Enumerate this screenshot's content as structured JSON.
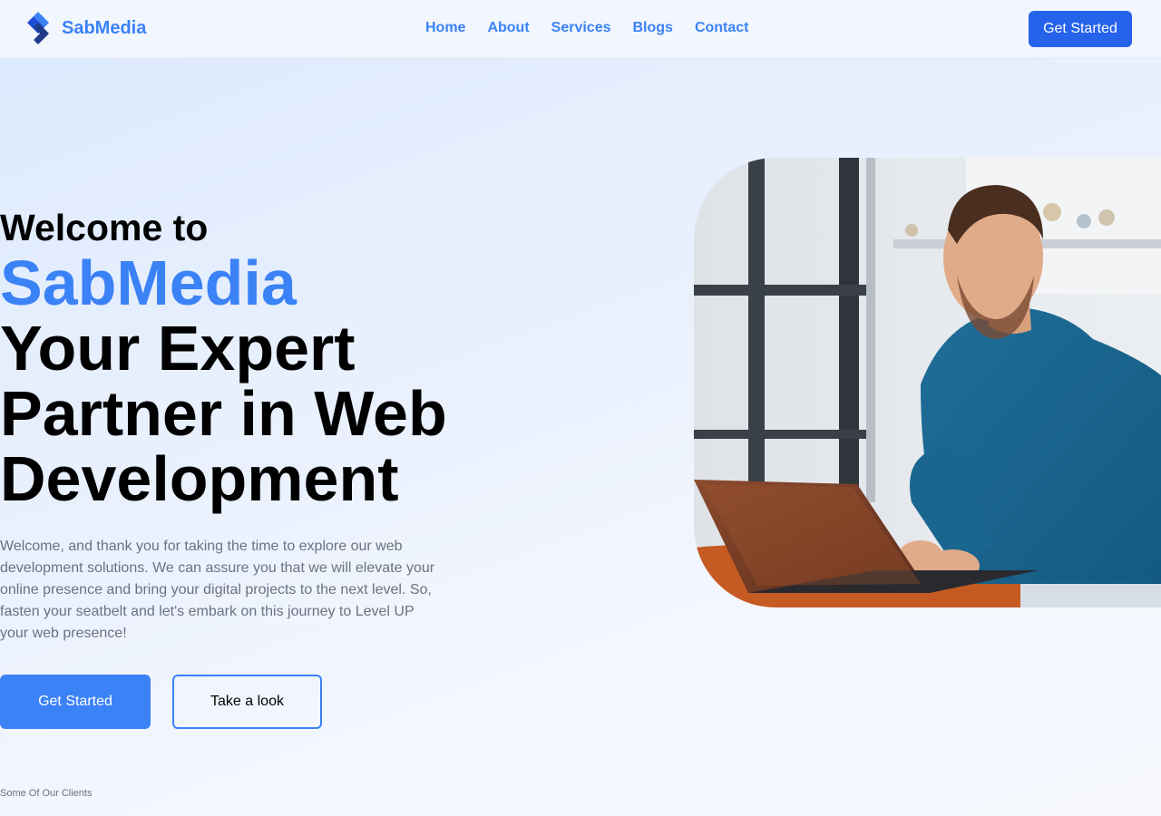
{
  "nav": {
    "brand": "SabMedia",
    "links": [
      "Home",
      "About",
      "Services",
      "Blogs",
      "Contact"
    ],
    "cta": "Get Started"
  },
  "hero": {
    "welcome": "Welcome to",
    "brand": "SabMedia",
    "headline_lines": [
      "Your Expert",
      "Partner in Web",
      "Development"
    ],
    "description": "Welcome, and thank you for taking the time to explore our web development solutions. We can assure you that we will elevate your online presence and bring your digital projects to the next level. So, fasten your seatbelt and let's embark on this journey to Level UP your web presence!",
    "primary_button": "Get Started",
    "secondary_button": "Take a look",
    "clients_label": "Some Of Our Clients"
  },
  "icons": {
    "logo": "brand-logo-icon"
  },
  "colors": {
    "accent": "#3b82f6",
    "cta": "#2563eb",
    "muted_text": "#6b7280"
  }
}
